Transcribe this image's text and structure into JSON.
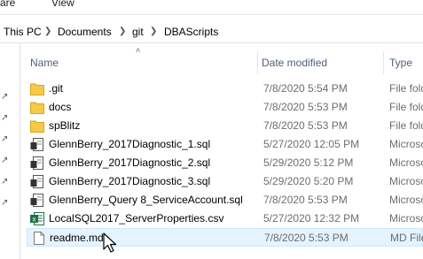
{
  "ribbon": {
    "tabs": [
      "are",
      "View"
    ]
  },
  "address": {
    "crumbs": [
      "This PC",
      "Documents",
      "git",
      "DBAScripts"
    ]
  },
  "columns": {
    "name": "Name",
    "date": "Date modified",
    "type": "Type"
  },
  "files": [
    {
      "name": ".git",
      "date": "7/8/2020 5:54 PM",
      "type": "File fold",
      "icon": "folder-icon"
    },
    {
      "name": "docs",
      "date": "7/8/2020 5:53 PM",
      "type": "File fold",
      "icon": "folder-icon"
    },
    {
      "name": "spBlitz",
      "date": "7/8/2020 5:53 PM",
      "type": "File fold",
      "icon": "folder-icon"
    },
    {
      "name": "GlennBerry_2017Diagnostic_1.sql",
      "date": "5/27/2020 12:05 PM",
      "type": "Microso",
      "icon": "sql-file-icon"
    },
    {
      "name": "GlennBerry_2017Diagnostic_2.sql",
      "date": "5/29/2020 5:12 PM",
      "type": "Microso",
      "icon": "sql-file-icon"
    },
    {
      "name": "GlennBerry_2017Diagnostic_3.sql",
      "date": "5/29/2020 5:20 PM",
      "type": "Microso",
      "icon": "sql-file-icon"
    },
    {
      "name": "GlennBerry_Query 8_ServiceAccount.sql",
      "date": "7/8/2020 5:53 PM",
      "type": "Microso",
      "icon": "sql-file-icon"
    },
    {
      "name": "LocalSQL2017_ServerProperties.csv",
      "date": "5/27/2020 12:32 PM",
      "type": "Microso",
      "icon": "excel-csv-icon"
    },
    {
      "name": "readme.md",
      "date": "7/8/2020 5:53 PM",
      "type": "MD File",
      "icon": "text-file-icon"
    }
  ],
  "selected_row": "readme.md",
  "colors": {
    "folder": "#f7c948",
    "selection": "#e5f3ff",
    "excel": "#1e7145",
    "header_text": "#4c607a"
  }
}
